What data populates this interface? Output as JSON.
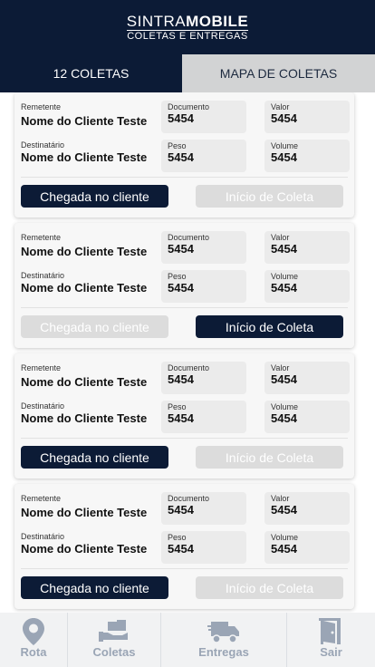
{
  "header": {
    "logo_part1": "SINTRA",
    "logo_part2": "MOBILE",
    "logo_sub": "COLETAS E ENTREGAS"
  },
  "tabs": [
    {
      "label": "12 COLETAS",
      "active": true
    },
    {
      "label": "MAPA DE COLETAS",
      "active": false
    }
  ],
  "cards": [
    {
      "remetente_label": "Remetente",
      "remetente": "Nome do Cliente Teste",
      "destinatario_label": "Destinatário",
      "destinatario": "Nome do Cliente Teste",
      "documento_label": "Documento",
      "documento": "5454",
      "valor_label": "Valor",
      "valor": "5454",
      "peso_label": "Peso",
      "peso": "5454",
      "volume_label": "Volume",
      "volume": "5454",
      "chegada_label": "Chegada no cliente",
      "chegada_enabled": true,
      "inicio_label": "Início de Coleta",
      "inicio_enabled": false
    },
    {
      "remetente_label": "Remetente",
      "remetente": "Nome do Cliente Teste",
      "destinatario_label": "Destinatário",
      "destinatario": "Nome do Cliente Teste",
      "documento_label": "Documento",
      "documento": "5454",
      "valor_label": "Valor",
      "valor": "5454",
      "peso_label": "Peso",
      "peso": "5454",
      "volume_label": "Volume",
      "volume": "5454",
      "chegada_label": "Chegada no cliente",
      "chegada_enabled": false,
      "inicio_label": "Início de Coleta",
      "inicio_enabled": true
    },
    {
      "remetente_label": "Remetente",
      "remetente": "Nome do Cliente Teste",
      "destinatario_label": "Destinatário",
      "destinatario": "Nome do Cliente Teste",
      "documento_label": "Documento",
      "documento": "5454",
      "valor_label": "Valor",
      "valor": "5454",
      "peso_label": "Peso",
      "peso": "5454",
      "volume_label": "Volume",
      "volume": "5454",
      "chegada_label": "Chegada no cliente",
      "chegada_enabled": true,
      "inicio_label": "Início de Coleta",
      "inicio_enabled": false
    },
    {
      "remetente_label": "Remetente",
      "remetente": "Nome do Cliente Teste",
      "destinatario_label": "Destinatário",
      "destinatario": "Nome do Cliente Teste",
      "documento_label": "Documento",
      "documento": "5454",
      "valor_label": "Valor",
      "valor": "5454",
      "peso_label": "Peso",
      "peso": "5454",
      "volume_label": "Volume",
      "volume": "5454",
      "chegada_label": "Chegada no cliente",
      "chegada_enabled": true,
      "inicio_label": "Início de Coleta",
      "inicio_enabled": false
    }
  ],
  "bottom_nav": [
    {
      "label": "Rota",
      "icon": "map-pin-icon"
    },
    {
      "label": "Coletas",
      "icon": "boxes-hand-icon"
    },
    {
      "label": "Entregas",
      "icon": "delivery-truck-icon"
    },
    {
      "label": "Sair",
      "icon": "door-exit-icon"
    }
  ],
  "colors": {
    "primary": "#0c1b36",
    "tab_inactive": "#d2d3d4",
    "button_disabled": "#dcdcdc",
    "nav_icon": "#9aa5b5"
  }
}
